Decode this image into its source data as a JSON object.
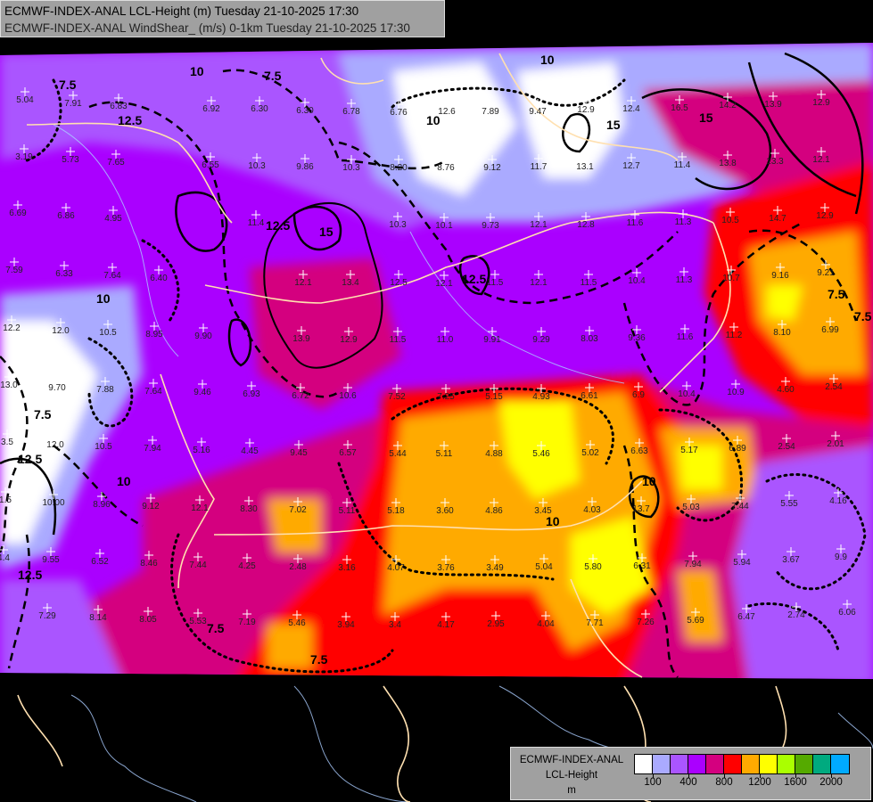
{
  "header": {
    "line1": "ECMWF-INDEX-ANAL LCL-Height (m) Tuesday 21-10-2025 17:30",
    "line2": "ECMWF-INDEX-ANAL WindShear_ (m/s) 0-1km Tuesday 21-10-2025 17:30"
  },
  "legend": {
    "model": "ECMWF-INDEX-ANAL",
    "parameter": "LCL-Height",
    "unit": "m",
    "colors": [
      "#ffffff",
      "#aaaaff",
      "#aa55ff",
      "#aa00ff",
      "#d4007f",
      "#ff0000",
      "#ffaa00",
      "#ffff00",
      "#aaff00",
      "#55aa00",
      "#00aa7f",
      "#00aaff"
    ],
    "tick_labels": [
      "100",
      "400",
      "800",
      "1200",
      "1600",
      "2000"
    ]
  },
  "map": {
    "contour_labels": [
      "7.5",
      "10",
      "12.5",
      "15",
      "7.5",
      "10",
      "12.5",
      "15",
      "7.5",
      "10",
      "12.5",
      "7.5",
      "10",
      "12.5",
      "7.5",
      "10",
      "15",
      "7.5",
      "10",
      "12.5",
      "7.5",
      "10"
    ],
    "station_values": [
      "5.04",
      "7.91",
      "6.83",
      "6.92",
      "6.30",
      "6.30",
      "6.78",
      "6.76",
      "12.6",
      "7.89",
      "9.47",
      "12.9",
      "12.4",
      "16.5",
      "14.2",
      "13.9",
      "12.9",
      "3.19",
      "5.73",
      "7.65",
      "6.55",
      "10.3",
      "9.86",
      "10.3",
      "8.20",
      "8.76",
      "9.12",
      "11.7",
      "13.1",
      "12.7",
      "11.4",
      "13.8",
      "13.3",
      "12.1",
      "6.69",
      "6.86",
      "4.95",
      "11.4",
      "10.3",
      "10.1",
      "9.73",
      "12.1",
      "12.8",
      "11.6",
      "11.3",
      "10.5",
      "14.7",
      "12.9",
      "7.59",
      "6.33",
      "7.64",
      "6.40",
      "12.1",
      "13.4",
      "12.5",
      "12.1",
      "11.5",
      "12.1",
      "11.5",
      "10.4",
      "11.3",
      "10.7",
      "9.16",
      "9.21",
      "12.2",
      "12.0",
      "10.5",
      "8.95",
      "9.90",
      "13.9",
      "12.9",
      "11.5",
      "11.0",
      "9.91",
      "9.29",
      "8.03",
      "9.36",
      "11.6",
      "11.2",
      "8.10",
      "6.99",
      "13.0",
      "9.70",
      "7.88",
      "7.64",
      "9.46",
      "6.93",
      "6.72",
      "10.6",
      "7.52",
      "7.25",
      "5.15",
      "4.93",
      "6.61",
      "6.9",
      "10.4",
      "10.9",
      "4.60",
      "2.54",
      "3.5",
      "12.0",
      "10.5",
      "7.94",
      "5.16",
      "4.45",
      "9.45",
      "6.57",
      "5.44",
      "5.11",
      "4.88",
      "5.46",
      "5.02",
      "6.63",
      "5.17",
      "6.89",
      "2.54",
      "2.01",
      "1.5",
      "10.00",
      "8.96",
      "9.12",
      "12.1",
      "8.30",
      "7.02",
      "5.11",
      "5.18",
      "3.60",
      "4.86",
      "3.45",
      "4.03",
      "13.7",
      "5.03",
      "7.44",
      "5.55",
      "4.16",
      "4.4",
      "9.55",
      "6.52",
      "8.46",
      "7.44",
      "4.25",
      "2.48",
      "3.16",
      "4.07",
      "3.76",
      "3.49",
      "5.04",
      "5.80",
      "6.31",
      "7.94",
      "5.94",
      "3.67",
      "9.9",
      "7.29",
      "8.14",
      "8.05",
      "5.53",
      "7.19",
      "5.46",
      "3.94",
      "3.4",
      "4.17",
      "2.95",
      "4.04",
      "7.71",
      "7.26",
      "5.69",
      "6.47",
      "2.74",
      "6.06"
    ]
  }
}
